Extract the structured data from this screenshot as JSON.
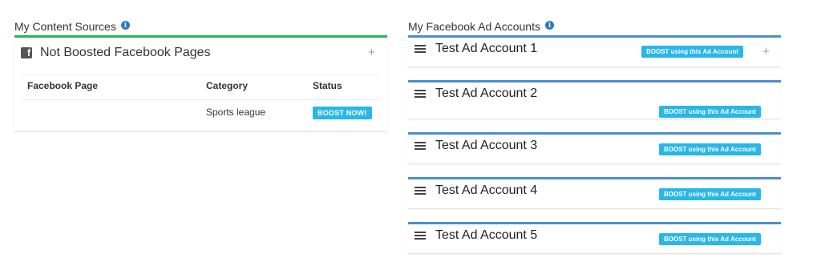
{
  "left": {
    "title": "My Content Sources",
    "panel_title": "Not Boosted Facebook Pages",
    "columns": [
      "Facebook Page",
      "Category",
      "Status"
    ],
    "rows": [
      {
        "page": "",
        "category": "Sports league",
        "status_button": "BOOST NOW!"
      }
    ]
  },
  "right": {
    "title": "My Facebook Ad Accounts",
    "accounts": [
      {
        "name": "Test Ad Account 1",
        "button": "BOOST using this Ad Account"
      },
      {
        "name": "Test Ad Account 2",
        "button": "BOOST using this Ad Account"
      },
      {
        "name": "Test Ad Account 3",
        "button": "BOOST using this Ad Account"
      },
      {
        "name": "Test Ad Account 4",
        "button": "BOOST using this Ad Account"
      },
      {
        "name": "Test Ad Account 5",
        "button": "BOOST using this Ad Account"
      }
    ]
  },
  "colors": {
    "content_panel_border": "#1eb955",
    "account_panel_border": "#4a8fcb",
    "boost_button": "#29b6e8",
    "info_icon": "#2a7bbd"
  },
  "icons": {
    "info": "info-icon",
    "facebook": "facebook-square-icon",
    "expand": "plus-icon",
    "account": "server-stack-icon"
  }
}
